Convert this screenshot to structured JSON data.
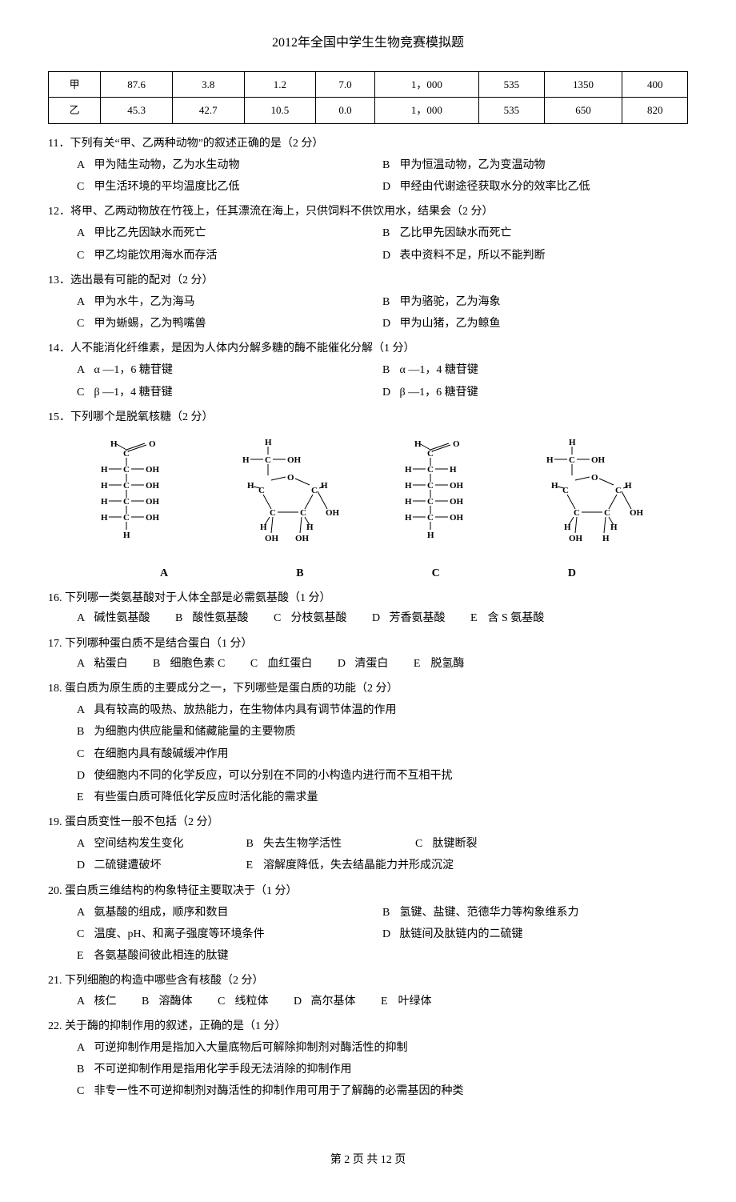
{
  "header": {
    "title": "2012年全国中学生生物竞赛模拟题"
  },
  "table": {
    "rows": [
      [
        "甲",
        "87.6",
        "3.8",
        "1.2",
        "7.0",
        "1，000",
        "535",
        "1350",
        "400"
      ],
      [
        "乙",
        "45.3",
        "42.7",
        "10.5",
        "0.0",
        "1，000",
        "535",
        "650",
        "820"
      ]
    ]
  },
  "q11": {
    "stem": "11．下列有关“甲、乙两种动物”的叙述正确的是（2 分）",
    "A": "甲为陆生动物，乙为水生动物",
    "B": "甲为恒温动物，乙为变温动物",
    "C": "甲生活环境的平均温度比乙低",
    "D": "甲经由代谢途径获取水分的效率比乙低"
  },
  "q12": {
    "stem": "12．将甲、乙两动物放在竹筏上，任其漂流在海上，只供饲料不供饮用水，结果会（2 分）",
    "A": "甲比乙先因缺水而死亡",
    "B": "乙比甲先因缺水而死亡",
    "C": "甲乙均能饮用海水而存活",
    "D": "表中资料不足，所以不能判断"
  },
  "q13": {
    "stem": "13．选出最有可能的配对（2 分）",
    "A": "甲为水牛，乙为海马",
    "B": "甲为骆驼，乙为海象",
    "C": "甲为蜥蜴，乙为鸭嘴兽",
    "D": "甲为山猪，乙为鲸鱼"
  },
  "q14": {
    "stem": "14．人不能消化纤维素，是因为人体内分解多糖的酶不能催化分解（1 分）",
    "A": "α —1，6 糖苷键",
    "B": "α —1，4 糖苷键",
    "C": "β —1，4 糖苷键",
    "D": "β —1，6 糖苷键"
  },
  "q15": {
    "stem": "15．下列哪个是脱氧核糖（2 分）",
    "labels": {
      "A": "A",
      "B": "B",
      "C": "C",
      "D": "D"
    }
  },
  "q16": {
    "stem": "16. 下列哪一类氨基酸对于人体全部是必需氨基酸（1 分）",
    "A": "碱性氨基酸",
    "B": "酸性氨基酸",
    "C": "分枝氨基酸",
    "D": "芳香氨基酸",
    "E": "含 S 氨基酸"
  },
  "q17": {
    "stem": "17. 下列哪种蛋白质不是结合蛋白（1 分）",
    "A": "粘蛋白",
    "B": "细胞色素 C",
    "C": "血红蛋白",
    "D": "清蛋白",
    "E": "脱氢酶"
  },
  "q18": {
    "stem": "18. 蛋白质为原生质的主要成分之一，下列哪些是蛋白质的功能（2 分）",
    "A": "具有较高的吸热、放热能力，在生物体内具有调节体温的作用",
    "B": "为细胞内供应能量和储藏能量的主要物质",
    "C": "在细胞内具有酸碱缓冲作用",
    "D": "使细胞内不同的化学反应，可以分别在不同的小构造内进行而不互相干扰",
    "E": "有些蛋白质可降低化学反应时活化能的需求量"
  },
  "q19": {
    "stem": "19. 蛋白质变性一般不包括（2 分）",
    "A": "空间结构发生变化",
    "B": "失去生物学活性",
    "C": "肽键断裂",
    "D": "二硫键遭破坏",
    "E": "溶解度降低，失去结晶能力并形成沉淀"
  },
  "q20": {
    "stem": "20. 蛋白质三维结构的构象特征主要取决于（1 分）",
    "A": "氨基酸的组成，顺序和数目",
    "B": "氢键、盐键、范德华力等构象维系力",
    "C": "温度、pH、和离子强度等环境条件",
    "D": "肽链间及肽链内的二硫键",
    "E": "各氨基酸间彼此相连的肽键"
  },
  "q21": {
    "stem": "21. 下列细胞的构造中哪些含有核酸（2 分）",
    "A": "核仁",
    "B": "溶酶体",
    "C": "线粒体",
    "D": "高尔基体",
    "E": "叶绿体"
  },
  "q22": {
    "stem": "22. 关于酶的抑制作用的叙述，正确的是（1 分）",
    "A": "可逆抑制作用是指加入大量底物后可解除抑制剂对酶活性的抑制",
    "B": "不可逆抑制作用是指用化学手段无法消除的抑制作用",
    "C": "非专一性不可逆抑制剂对酶活性的抑制作用可用于了解酶的必需基因的种类"
  },
  "footer": {
    "page_current": "2",
    "page_total": "12",
    "prefix": "第",
    "mid": "页 共",
    "suffix": "页"
  }
}
